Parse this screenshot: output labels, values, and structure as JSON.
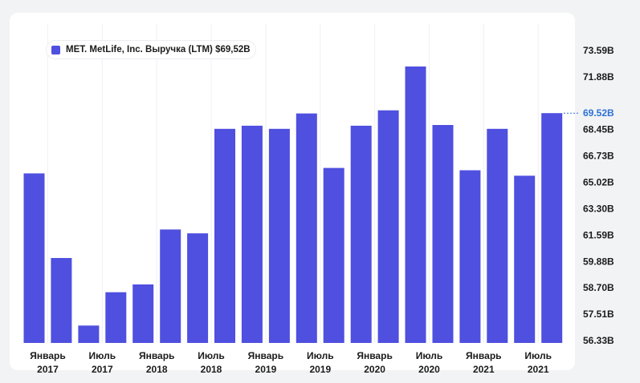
{
  "chart_data": {
    "type": "bar",
    "legend": "MET. MetLife, Inc. Выручка (LTM) $69,52B",
    "bar_color": "#4f4fe0",
    "current_color": "#2c72d4",
    "current_label": "69.52B",
    "current_value": 69.52,
    "y_ticks": [
      {
        "value": 56.33,
        "label": "56.33B"
      },
      {
        "value": 57.51,
        "label": "57.51B"
      },
      {
        "value": 58.7,
        "label": "58.70B"
      },
      {
        "value": 59.88,
        "label": "59.88B"
      },
      {
        "value": 61.59,
        "label": "61.59B"
      },
      {
        "value": 63.3,
        "label": "63.30B"
      },
      {
        "value": 65.02,
        "label": "65.02B"
      },
      {
        "value": 66.73,
        "label": "66.73B"
      },
      {
        "value": 68.45,
        "label": "68.45B"
      },
      {
        "value": 71.88,
        "label": "71.88B"
      },
      {
        "value": 73.59,
        "label": "73.59B"
      }
    ],
    "ylim": [
      56.33,
      73.59
    ],
    "values": [
      65.6,
      60.1,
      57.0,
      58.5,
      58.85,
      61.95,
      61.7,
      68.5,
      68.7,
      68.5,
      69.5,
      65.95,
      68.7,
      69.7,
      72.55,
      68.75,
      65.8,
      68.5,
      65.45,
      69.52
    ],
    "x_labels": [
      {
        "index": 1,
        "line1": "Январь",
        "line2": "2017"
      },
      {
        "index": 3,
        "line1": "Июль",
        "line2": "2017"
      },
      {
        "index": 5,
        "line1": "Январь",
        "line2": "2018"
      },
      {
        "index": 7,
        "line1": "Июль",
        "line2": "2018"
      },
      {
        "index": 9,
        "line1": "Январь",
        "line2": "2019"
      },
      {
        "index": 11,
        "line1": "Июль",
        "line2": "2019"
      },
      {
        "index": 13,
        "line1": "Январь",
        "line2": "2020"
      },
      {
        "index": 15,
        "line1": "Июль",
        "line2": "2020"
      },
      {
        "index": 17,
        "line1": "Январь",
        "line2": "2021"
      },
      {
        "index": 19,
        "line1": "Июль",
        "line2": "2021"
      }
    ],
    "grid": "vertical"
  }
}
